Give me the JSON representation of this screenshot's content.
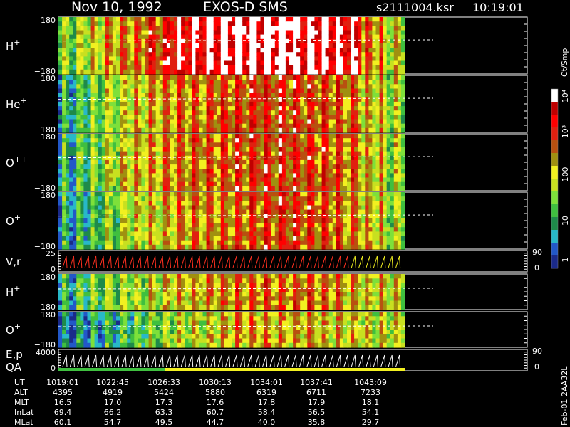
{
  "header": {
    "date": "Nov 10, 1992",
    "mission": "EXOS-D SMS",
    "file": "s2111004.ksr",
    "time": "10:19:01"
  },
  "colors": {
    "background": "#000000",
    "scale": [
      "#1a2a8a",
      "#2258c8",
      "#28b8c8",
      "#1e8a4a",
      "#3fbf3f",
      "#7ee03a",
      "#c8e020",
      "#f2f020",
      "#a09010",
      "#b85010",
      "#e02010",
      "#ff0000",
      "#c00000",
      "#ffffff"
    ]
  },
  "colorbar": {
    "unit": "Ct/Smp",
    "ticks": [
      "1",
      "10",
      "100",
      "10³",
      "10⁴"
    ]
  },
  "chart_data": [
    {
      "type": "heatmap",
      "panel": "H+ pitch angle",
      "label": "H",
      "superscript": "+",
      "y_ticks": [
        "180",
        "−180"
      ],
      "ylim": [
        -180,
        180
      ],
      "intensity_profile": [
        0.35,
        0.45,
        0.55,
        0.6,
        0.7,
        0.8,
        0.85,
        0.9,
        0.92,
        0.95,
        0.95,
        0.9,
        0.88,
        0.85,
        0.6,
        0.45
      ]
    },
    {
      "type": "heatmap",
      "panel": "He+ pitch angle",
      "label": "He",
      "superscript": "+",
      "y_ticks": [
        "180",
        "−180"
      ],
      "ylim": [
        -180,
        180
      ],
      "intensity_profile": [
        0.2,
        0.3,
        0.4,
        0.5,
        0.55,
        0.6,
        0.62,
        0.65,
        0.68,
        0.7,
        0.7,
        0.68,
        0.65,
        0.62,
        0.5,
        0.4
      ]
    },
    {
      "type": "heatmap",
      "panel": "O++ pitch angle",
      "label": "O",
      "superscript": "++",
      "y_ticks": [
        "180",
        "−180"
      ],
      "ylim": [
        -180,
        180
      ],
      "intensity_profile": [
        0.2,
        0.3,
        0.42,
        0.5,
        0.56,
        0.6,
        0.63,
        0.65,
        0.68,
        0.7,
        0.7,
        0.68,
        0.66,
        0.62,
        0.5,
        0.4
      ]
    },
    {
      "type": "heatmap",
      "panel": "O+ pitch angle",
      "label": "O",
      "superscript": "+",
      "y_ticks": [
        "180",
        "−180"
      ],
      "ylim": [
        -180,
        180
      ],
      "intensity_profile": [
        0.18,
        0.25,
        0.35,
        0.45,
        0.5,
        0.55,
        0.6,
        0.62,
        0.65,
        0.68,
        0.7,
        0.68,
        0.65,
        0.6,
        0.5,
        0.4
      ]
    },
    {
      "type": "line",
      "panel": "V, r",
      "label": "V,r",
      "y_ticks": [
        "25",
        "0"
      ],
      "right_ticks": [
        "90",
        "0"
      ]
    },
    {
      "type": "heatmap",
      "panel": "H+ lower",
      "label": "H",
      "superscript": "+",
      "y_ticks": [
        "180",
        "−180"
      ],
      "ylim": [
        -180,
        180
      ],
      "intensity_profile": [
        0.2,
        0.3,
        0.35,
        0.4,
        0.45,
        0.5,
        0.55,
        0.58,
        0.6,
        0.62,
        0.63,
        0.64,
        0.6,
        0.55,
        0.5,
        0.45
      ]
    },
    {
      "type": "heatmap",
      "panel": "O+ lower",
      "label": "O",
      "superscript": "+",
      "y_ticks": [
        "180",
        "−180"
      ],
      "ylim": [
        -180,
        180
      ],
      "intensity_profile": [
        0.1,
        0.15,
        0.2,
        0.28,
        0.35,
        0.4,
        0.45,
        0.5,
        0.55,
        0.55,
        0.55,
        0.55,
        0.5,
        0.5,
        0.45,
        0.45
      ]
    },
    {
      "type": "line",
      "panel": "E, p / QA",
      "label": "E,p",
      "label2": "QA",
      "y_ticks": [
        "4000",
        "0"
      ],
      "right_ticks": [
        "90",
        "0"
      ]
    }
  ],
  "footer": {
    "rows": [
      {
        "name": "UT",
        "values": [
          "1019:01",
          "1022:45",
          "1026:33",
          "1030:13",
          "1034:01",
          "1037:41",
          "1043:09"
        ]
      },
      {
        "name": "ALT",
        "values": [
          "4395",
          "4919",
          "5424",
          "5880",
          "6319",
          "6711",
          "7233"
        ]
      },
      {
        "name": "MLT",
        "values": [
          "16.5",
          "17.0",
          "17.3",
          "17.6",
          "17.8",
          "17.9",
          "18.1"
        ]
      },
      {
        "name": "InLat",
        "values": [
          "69.4",
          "66.2",
          "63.3",
          "60.7",
          "58.4",
          "56.5",
          "54.1"
        ]
      },
      {
        "name": "MLat",
        "values": [
          "60.1",
          "54.7",
          "49.5",
          "44.7",
          "40.0",
          "35.8",
          "29.7"
        ]
      }
    ],
    "side_note": "Feb-01 2AA32L"
  }
}
